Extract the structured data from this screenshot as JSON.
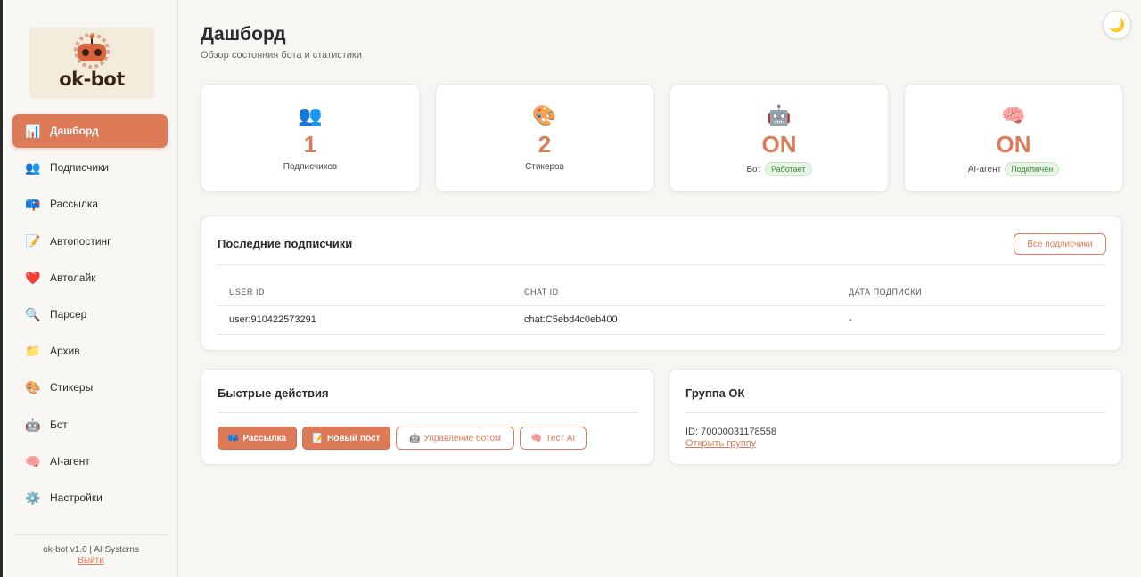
{
  "sidebar": {
    "logo_text": "ok-bot",
    "items": [
      {
        "label": "Дашборд",
        "icon": "bar-chart-icon",
        "glyph": "📊",
        "active": true
      },
      {
        "label": "Подписчики",
        "icon": "users-icon",
        "glyph": "👥",
        "active": false
      },
      {
        "label": "Рассылка",
        "icon": "mailbox-icon",
        "glyph": "📪",
        "active": false
      },
      {
        "label": "Автопостинг",
        "icon": "memo-icon",
        "glyph": "📝",
        "active": false
      },
      {
        "label": "Автолайк",
        "icon": "heart-icon",
        "glyph": "❤️",
        "active": false
      },
      {
        "label": "Парсер",
        "icon": "magnifier-icon",
        "glyph": "🔍",
        "active": false
      },
      {
        "label": "Архив",
        "icon": "folder-icon",
        "glyph": "📁",
        "active": false
      },
      {
        "label": "Стикеры",
        "icon": "palette-icon",
        "glyph": "🎨",
        "active": false
      },
      {
        "label": "Бот",
        "icon": "robot-icon",
        "glyph": "🤖",
        "active": false
      },
      {
        "label": "AI-агент",
        "icon": "brain-icon",
        "glyph": "🧠",
        "active": false
      },
      {
        "label": "Настройки",
        "icon": "gear-icon",
        "glyph": "⚙️",
        "active": false
      }
    ],
    "footer_text": "ok-bot v1.0 | AI Systems",
    "logout_label": "Выйти"
  },
  "header": {
    "title": "Дашборд",
    "subtitle": "Обзор состояния бота и статистики",
    "theme_icon": "moon-icon"
  },
  "stats": [
    {
      "icon": "users-icon",
      "glyph": "👥",
      "value": "1",
      "label": "Подписчиков",
      "badge": ""
    },
    {
      "icon": "palette-icon",
      "glyph": "🎨",
      "value": "2",
      "label": "Стикеров",
      "badge": ""
    },
    {
      "icon": "robot-icon",
      "glyph": "🤖",
      "value": "ON",
      "label": "Бот",
      "badge": "Работает"
    },
    {
      "icon": "brain-icon",
      "glyph": "🧠",
      "value": "ON",
      "label": "AI-агент",
      "badge": "Подключён"
    }
  ],
  "subscribers": {
    "title": "Последние подписчики",
    "all_button": "Все подписчики",
    "columns": [
      "USER ID",
      "CHAT ID",
      "ДАТА ПОДПИСКИ"
    ],
    "rows": [
      [
        "user:910422573291",
        "chat:C5ebd4c0eb400",
        "-"
      ]
    ]
  },
  "quick_actions": {
    "title": "Быстрые действия",
    "buttons": [
      {
        "label": "Рассылка",
        "icon": "mailbox-icon",
        "glyph": "📪"
      },
      {
        "label": "Новый пост",
        "icon": "memo-icon",
        "glyph": "📝"
      },
      {
        "label": "Управление ботом",
        "icon": "robot-icon",
        "glyph": "🤖"
      },
      {
        "label": "Тест AI",
        "icon": "brain-icon",
        "glyph": "🧠"
      }
    ]
  },
  "group": {
    "title": "Группа ОК",
    "id_text": "ID: 70000031178558",
    "open_link": "Открыть группу"
  },
  "colors": {
    "accent": "#dd7b58",
    "success_bg": "#e7f4e6",
    "success_text": "#3b8a3b"
  }
}
